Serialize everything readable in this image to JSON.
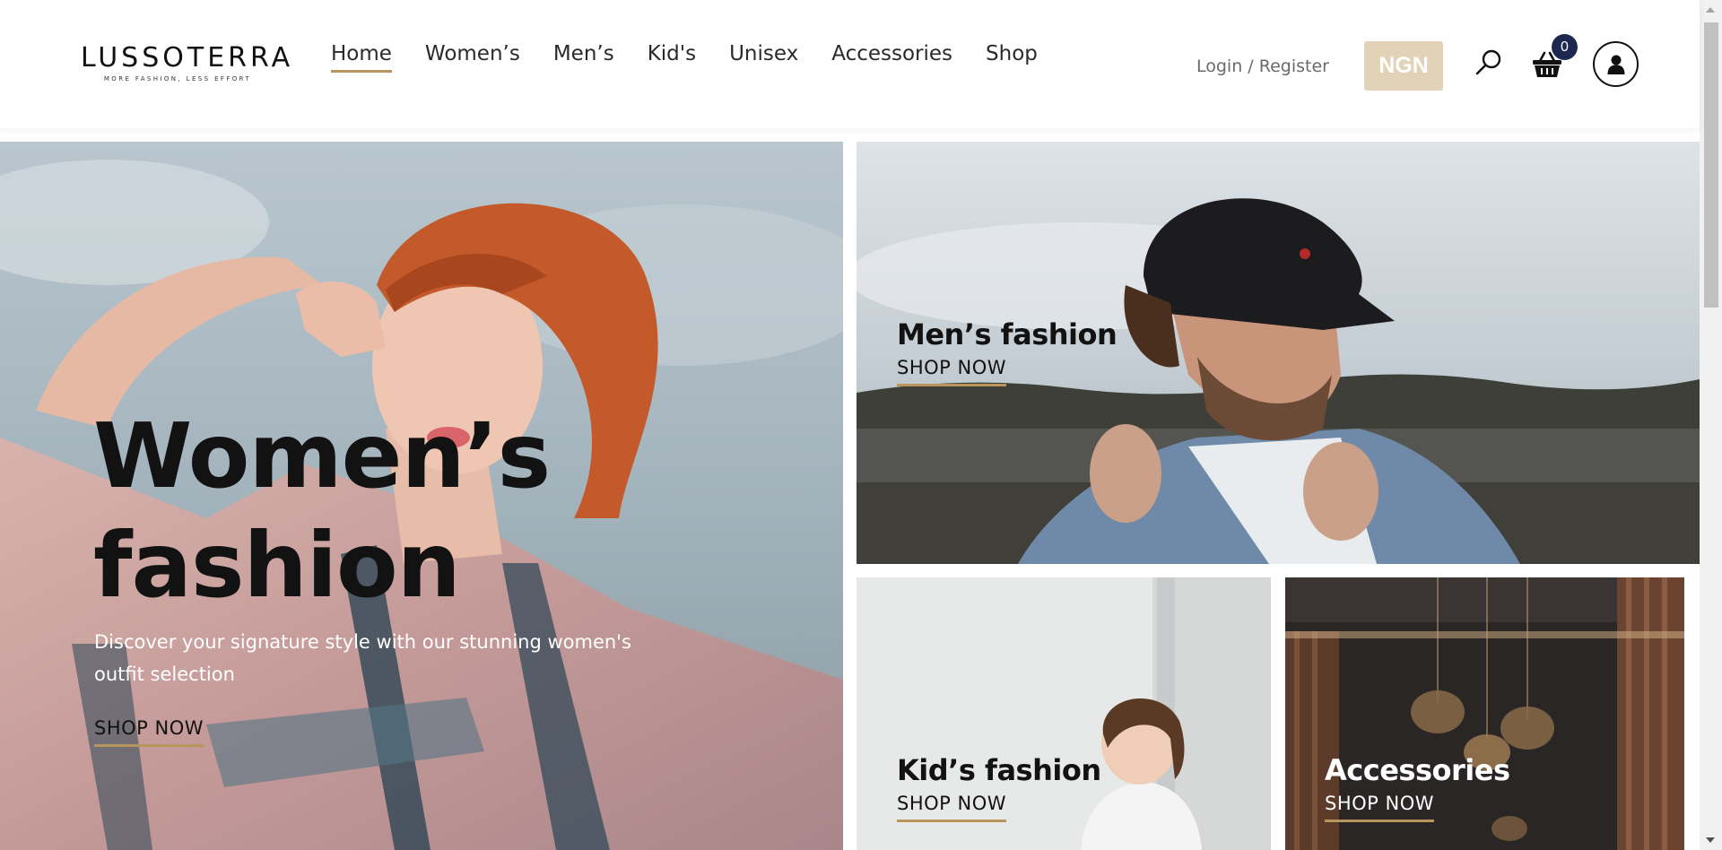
{
  "brand": {
    "name": "LUSSOTERRA",
    "tagline": "MORE FASHION, LESS EFFORT"
  },
  "nav": {
    "items": [
      {
        "label": "Home",
        "active": true
      },
      {
        "label": "Women’s",
        "active": false
      },
      {
        "label": "Men’s",
        "active": false
      },
      {
        "label": "Kid's",
        "active": false
      },
      {
        "label": "Unisex",
        "active": false
      },
      {
        "label": "Accessories",
        "active": false
      },
      {
        "label": "Shop",
        "active": false
      }
    ]
  },
  "header": {
    "login_label": "Login / Register",
    "currency": "NGN",
    "cart_count": "0",
    "search_icon": "search-icon",
    "cart_icon": "basket-icon",
    "account_icon": "user-icon"
  },
  "hero": {
    "women": {
      "title_line1": "Women’s",
      "title_line2": "fashion",
      "description": "Discover your signature style with our stunning women's outfit selection",
      "cta": "SHOP NOW"
    },
    "men": {
      "title": "Men’s fashion",
      "cta": "SHOP NOW"
    },
    "kids": {
      "title": "Kid’s fashion",
      "cta": "SHOP NOW"
    },
    "accessories": {
      "title": "Accessories",
      "cta": "SHOP NOW"
    }
  },
  "colors": {
    "accent_gold": "#b8955a",
    "currency_bg": "#e1d2b8",
    "badge_navy": "#1d2850"
  }
}
